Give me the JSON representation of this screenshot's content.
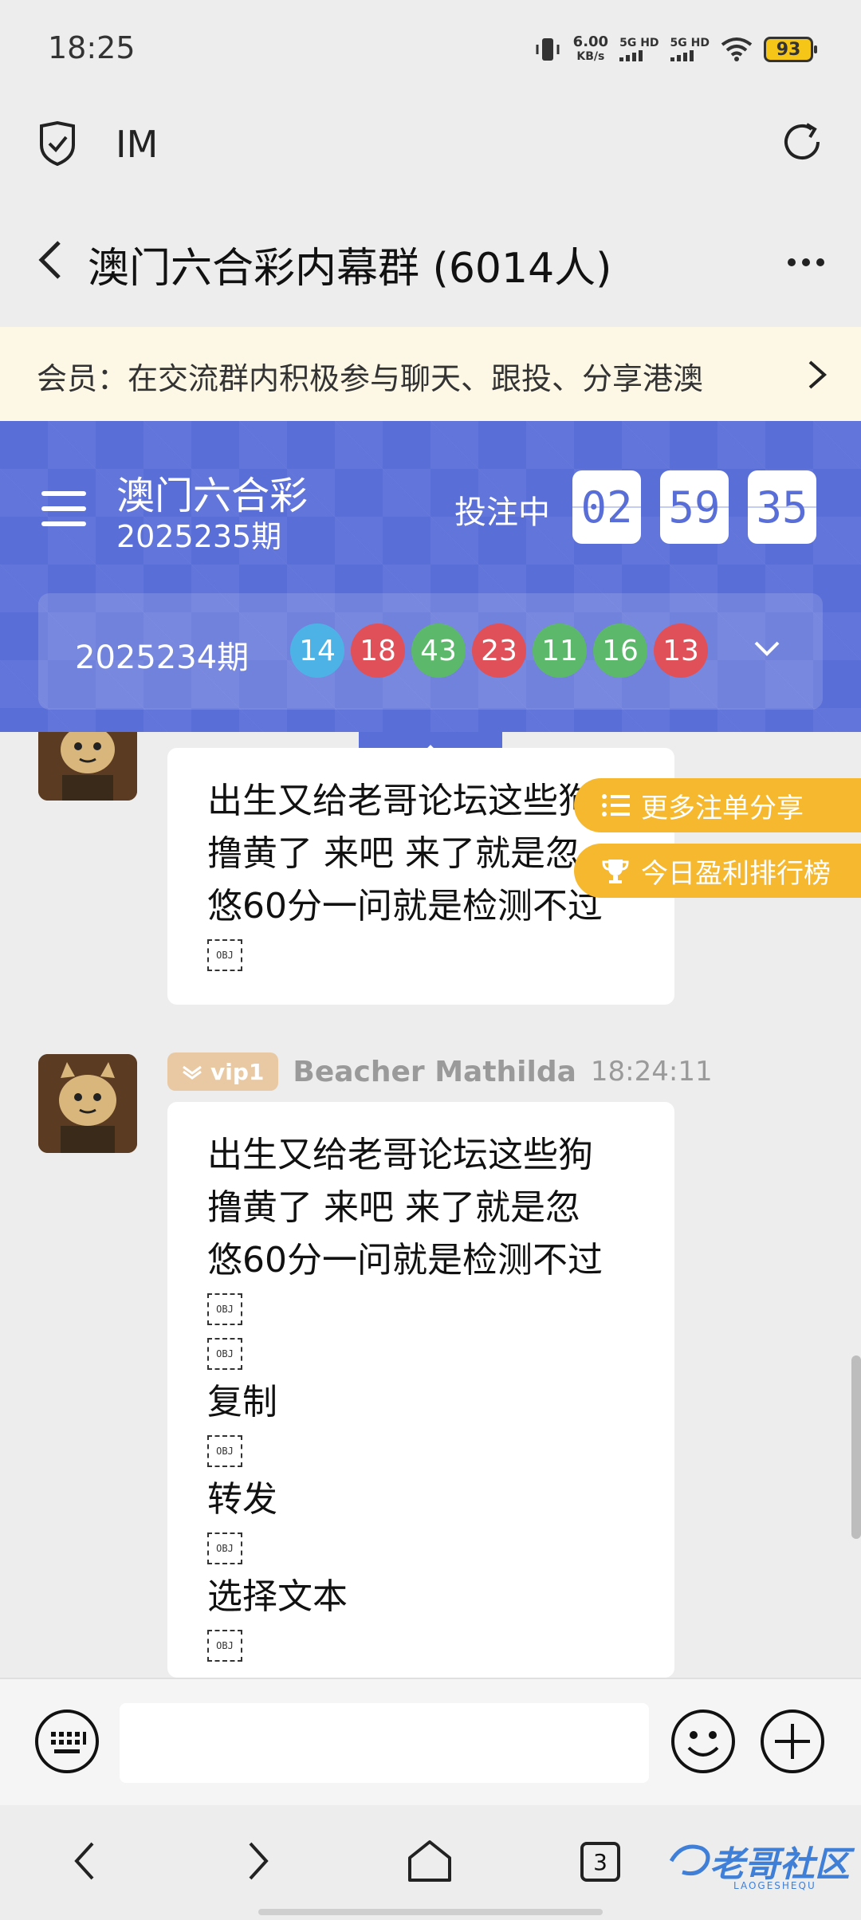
{
  "status_bar": {
    "time": "18:25",
    "speed_value": "6.00",
    "speed_unit": "KB/s",
    "net1": "5G HD",
    "net2": "5G HD",
    "battery": "93"
  },
  "browser": {
    "title": "IM"
  },
  "chat": {
    "title": "澳门六合彩内幕群 (6014人)"
  },
  "notice": {
    "text": "会员：在交流群内积极参与聊天、跟投、分享港澳"
  },
  "lottery": {
    "game": "澳门六合彩",
    "current_period": "2025235期",
    "status": "投注中",
    "timer": [
      "02",
      "59",
      "35"
    ],
    "last_period": "2025234期",
    "last_numbers": [
      {
        "n": "14",
        "color": "#4db3e6"
      },
      {
        "n": "18",
        "color": "#e05058"
      },
      {
        "n": "43",
        "color": "#5cb86a"
      },
      {
        "n": "23",
        "color": "#e05058"
      },
      {
        "n": "11",
        "color": "#5cb86a"
      },
      {
        "n": "16",
        "color": "#5cb86a"
      },
      {
        "n": "13",
        "color": "#e05058"
      }
    ]
  },
  "float_buttons": {
    "more_share": "更多注单分享",
    "ranking": "今日盈利排行榜"
  },
  "messages": [
    {
      "lines": [
        "出生又给老哥论坛这些狗",
        "撸黄了 来吧 来了就是忽",
        "悠60分一问就是检测不过"
      ],
      "obj": "OBJ"
    },
    {
      "vip": "vip1",
      "sender": "Beacher Mathilda",
      "time": "18:24:11",
      "lines": [
        "出生又给老哥论坛这些狗",
        "撸黄了 来吧 来了就是忽",
        "悠60分一问就是检测不过"
      ],
      "obj": "OBJ",
      "menu": [
        "复制",
        "转发",
        "选择文本"
      ]
    }
  ],
  "input": {
    "placeholder": ""
  },
  "nav": {
    "tab_count": "3"
  },
  "watermark": {
    "text": "老哥社区",
    "sub": "LAOGESHEQU"
  }
}
